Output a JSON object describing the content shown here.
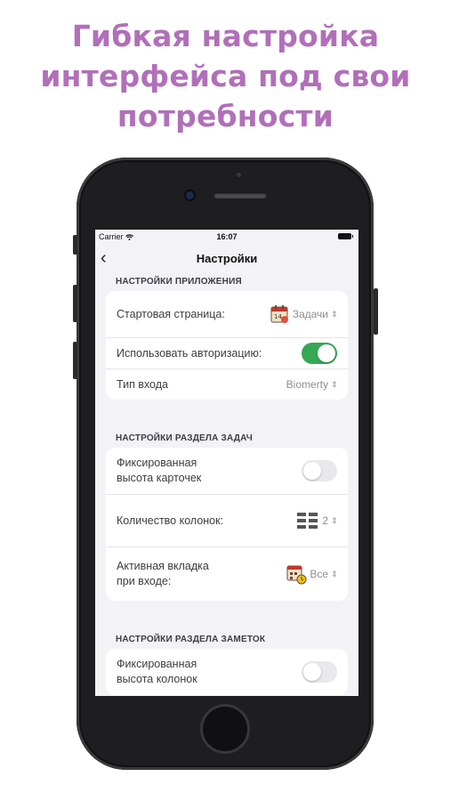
{
  "headline": [
    "Гибкая настройка",
    "интерфейса под свои",
    "потребности"
  ],
  "status_bar": {
    "carrier": "Carrier",
    "time": "16:07"
  },
  "nav": {
    "title": "Настройки"
  },
  "sections": [
    {
      "header": "НАСТРОЙКИ ПРИЛОЖЕНИЯ",
      "rows": [
        {
          "label": "Стартовая страница:",
          "value": "Задачи",
          "icon": "calendar-icon"
        },
        {
          "label": "Использовать авторизацию:",
          "toggle": true
        },
        {
          "label": "Тип входа",
          "value": "Biomerty"
        }
      ]
    },
    {
      "header": "НАСТРОЙКИ РАЗДЕЛА ЗАДАЧ",
      "rows": [
        {
          "label_lines": [
            "Фиксированная",
            "высота карточек"
          ],
          "toggle": false
        },
        {
          "label": "Количество колонок:",
          "value": "2",
          "icon": "grid-icon"
        },
        {
          "label_lines": [
            "Активная вкладка",
            "при входе:"
          ],
          "value": "Все",
          "icon": "tasks-icon"
        }
      ]
    },
    {
      "header": "НАСТРОЙКИ РАЗДЕЛА ЗАМЕТОК",
      "rows": [
        {
          "label_lines": [
            "Фиксированная",
            "высота колонок"
          ],
          "toggle": false
        }
      ]
    }
  ],
  "colors": {
    "headline": "#b16fba",
    "toggle_on": "#34a853",
    "toggle_off": "#e9e9eb",
    "screen_bg": "#f2f2f7"
  }
}
